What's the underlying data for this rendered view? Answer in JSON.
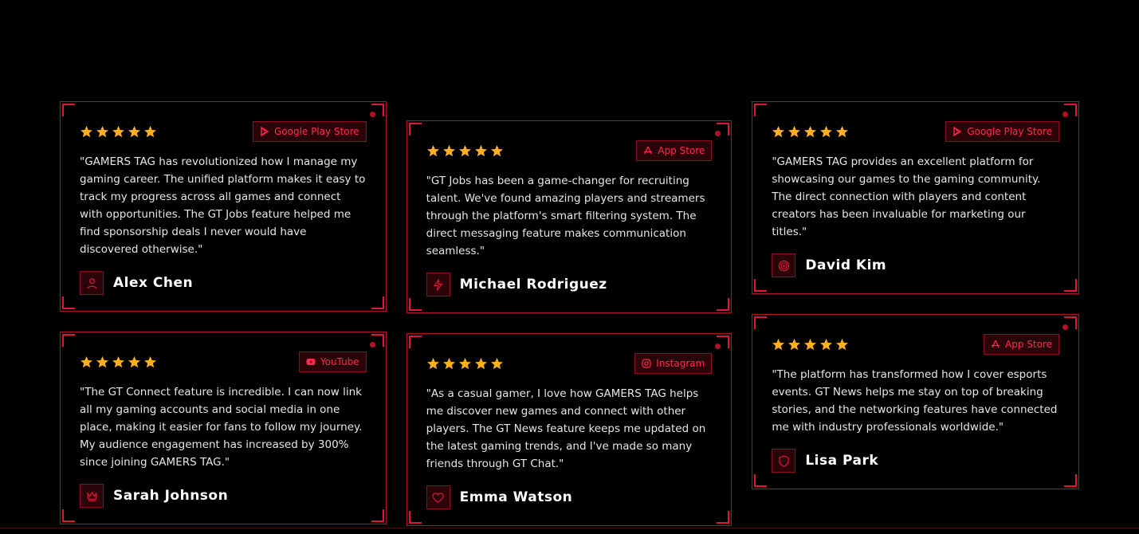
{
  "colors": {
    "accent": "#e0153a",
    "star": "#ffb020",
    "border": "#b5102a"
  },
  "testimonials": [
    {
      "platform": "Google Play Store",
      "platform_icon": "play-store-icon",
      "rating": 5,
      "quote": "\"GAMERS TAG has revolutionized how I manage my gaming career. The unified platform makes it easy to track my progress across all games and connect with opportunities. The GT Jobs feature helped me find sponsorship deals I never would have discovered otherwise.\"",
      "name": "Alex Chen",
      "avatar_icon": "user-icon"
    },
    {
      "platform": "App Store",
      "platform_icon": "app-store-icon",
      "rating": 5,
      "quote": "\"GT Jobs has been a game-changer for recruiting talent. We've found amazing players and streamers through the platform's smart filtering system. The direct messaging feature makes communication seamless.\"",
      "name": "Michael Rodriguez",
      "avatar_icon": "lightning-icon"
    },
    {
      "platform": "Google Play Store",
      "platform_icon": "play-store-icon",
      "rating": 5,
      "quote": "\"GAMERS TAG provides an excellent platform for showcasing our games to the gaming community. The direct connection with players and content creators has been invaluable for marketing our titles.\"",
      "name": "David Kim",
      "avatar_icon": "target-icon"
    },
    {
      "platform": "YouTube",
      "platform_icon": "youtube-icon",
      "rating": 5,
      "quote": "\"The GT Connect feature is incredible. I can now link all my gaming accounts and social media in one place, making it easier for fans to follow my journey. My audience engagement has increased by 300% since joining GAMERS TAG.\"",
      "name": "Sarah Johnson",
      "avatar_icon": "crown-icon"
    },
    {
      "platform": "Instagram",
      "platform_icon": "instagram-icon",
      "rating": 5,
      "quote": "\"As a casual gamer, I love how GAMERS TAG helps me discover new games and connect with other players. The GT News feature keeps me updated on the latest gaming trends, and I've made so many friends through GT Chat.\"",
      "name": "Emma Watson",
      "avatar_icon": "heart-icon"
    },
    {
      "platform": "App Store",
      "platform_icon": "app-store-icon",
      "rating": 5,
      "quote": "\"The platform has transformed how I cover esports events. GT News helps me stay on top of breaking stories, and the networking features have connected me with industry professionals worldwide.\"",
      "name": "Lisa Park",
      "avatar_icon": "shield-icon"
    }
  ]
}
